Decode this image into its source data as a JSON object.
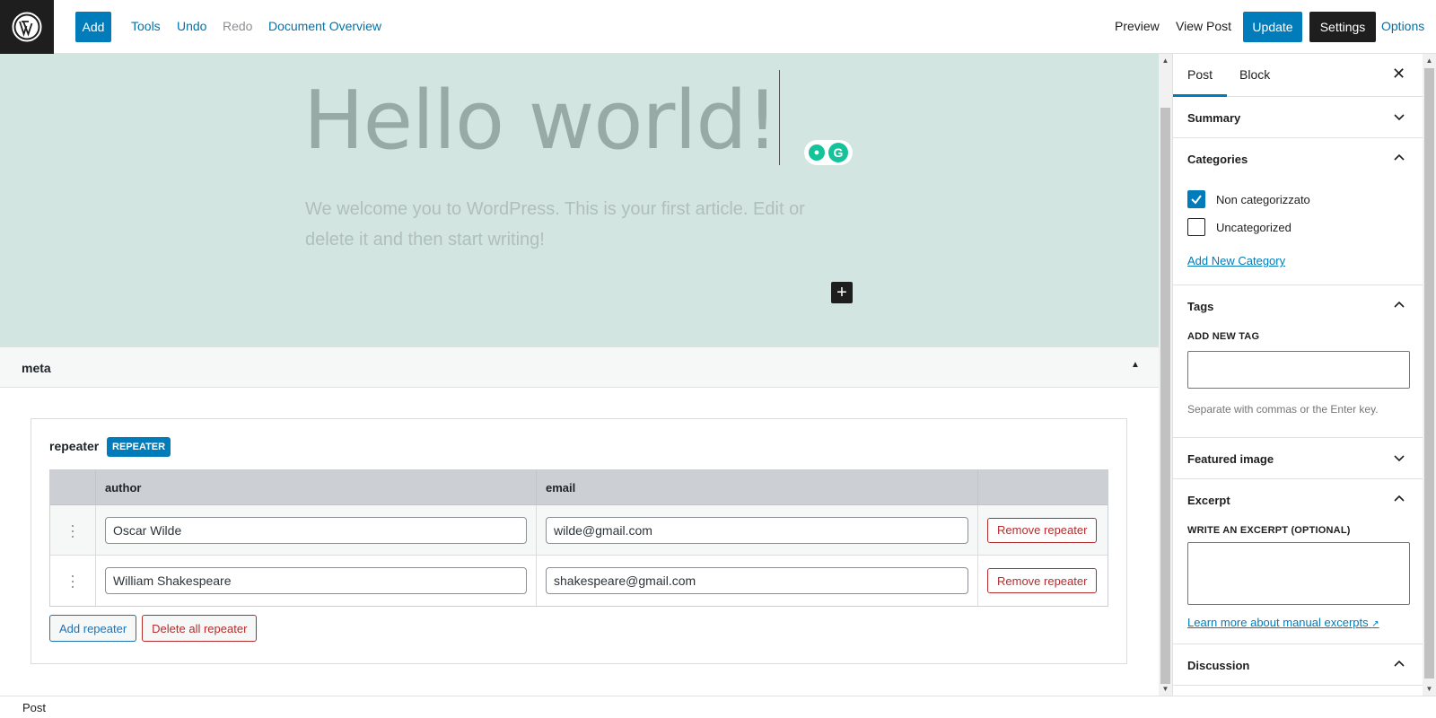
{
  "toolbar": {
    "add_label": "Add",
    "tools_label": "Tools",
    "undo_label": "Undo",
    "redo_label": "Redo",
    "document_overview_label": "Document Overview",
    "preview_label": "Preview",
    "view_post_label": "View Post",
    "update_label": "Update",
    "settings_label": "Settings",
    "options_label": "Options"
  },
  "editor": {
    "title": "Hello world!",
    "excerpt": "We welcome you to WordPress. This is your first article. Edit or delete it and then start writing!",
    "inserter_label": "+",
    "canvas_color": "#d3e5e0"
  },
  "meta": {
    "title": "meta",
    "toggle": "▲",
    "repeater": {
      "label": "repeater",
      "badge": "REPEATER",
      "columns": [
        "author",
        "email"
      ],
      "rows": [
        {
          "author": "Oscar Wilde",
          "email": "wilde@gmail.com",
          "remove_label": "Remove repeater"
        },
        {
          "author": "William Shakespeare",
          "email": "shakespeare@gmail.com",
          "remove_label": "Remove repeater"
        }
      ],
      "add_label": "Add repeater",
      "delete_all_label": "Delete all repeater"
    }
  },
  "sidebar": {
    "tabs": [
      "Post",
      "Block"
    ],
    "active_tab": "Post",
    "close": "✕",
    "summary_title": "Summary",
    "categories": {
      "title": "Categories",
      "items": [
        {
          "label": "Non categorizzato",
          "checked": true
        },
        {
          "label": "Uncategorized",
          "checked": false
        }
      ],
      "add_new_label": "Add New Category"
    },
    "tags": {
      "title": "Tags",
      "add_new_label": "ADD NEW TAG",
      "input_value": "",
      "help": "Separate with commas or the Enter key."
    },
    "featured_image_title": "Featured image",
    "excerpt": {
      "title": "Excerpt",
      "label": "WRITE AN EXCERPT (OPTIONAL)",
      "value": "",
      "learn_more": "Learn more about manual excerpts"
    },
    "discussion_title": "Discussion"
  },
  "footer": {
    "breadcrumb": "Post"
  },
  "colors": {
    "accent": "#007cba",
    "danger": "#b32d2e",
    "dark": "#1e1e1e"
  }
}
